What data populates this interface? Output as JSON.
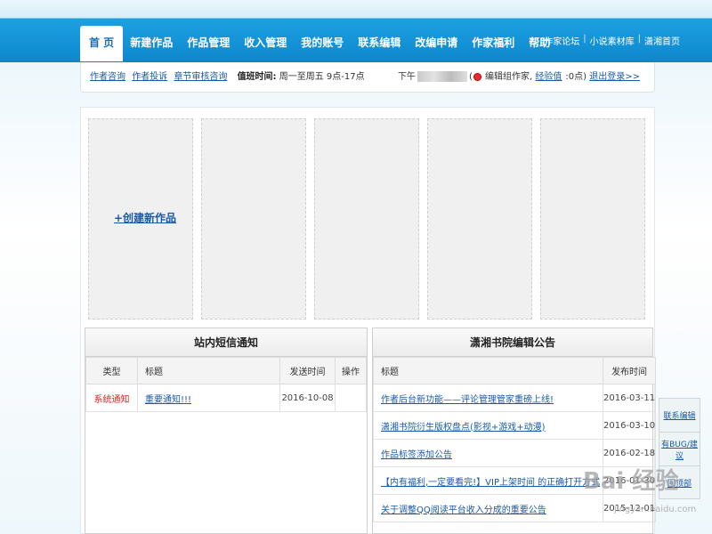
{
  "nav": {
    "items": [
      "首 页",
      "新建作品",
      "作品管理",
      "收入管理",
      "我的账号",
      "联系编辑",
      "改编申请",
      "作家福利",
      "帮助"
    ],
    "active": "首 页"
  },
  "top_links": [
    "作家论坛",
    "小说素材库",
    "潇湘首页"
  ],
  "subbar": {
    "links": [
      "作者咨询",
      "作者投诉",
      "章节审核咨询"
    ],
    "hours_label": "值班时间:",
    "hours_value": "周一至周五 9点-17点",
    "greeting_prefix": "下午",
    "role_text": "编辑组作家,",
    "exp_label": "经验值",
    "exp_value": ":0点)",
    "logout": "退出登录>>"
  },
  "create_work": "+创建新作品",
  "messages_panel": {
    "title": "站内短信通知",
    "columns": [
      "类型",
      "标题",
      "发送时间",
      "操作"
    ],
    "rows": [
      {
        "type": "系统通知",
        "title": "重要通知!!!",
        "time": "2016-10-08",
        "action": ""
      }
    ]
  },
  "announcements_panel": {
    "title": "潇湘书院编辑公告",
    "columns": [
      "标题",
      "发布时间"
    ],
    "rows": [
      {
        "title": "作者后台新功能——评论管理管家重磅上线!",
        "date": "2016-03-11"
      },
      {
        "title": "潇湘书院衍生版权盘点(影视+游戏+动漫)",
        "date": "2016-03-10"
      },
      {
        "title": "作品标签添加公告",
        "date": "2016-02-18"
      },
      {
        "title": "【内有福利,一定要看完!】VIP上架时间 的正确打开方式",
        "date": "2016-01-30"
      },
      {
        "title": "关于调整QQ阅读平台收入分成的重要公告",
        "date": "2015-12-01"
      }
    ]
  },
  "side_tabs": [
    "联系编辑",
    "有BUG/建议",
    "回顶部"
  ],
  "watermark": "Bai 经验",
  "watermark_sub": "jingyan.baidu.com",
  "colors": {
    "nav_blue": "#1493d7",
    "link_blue": "#1a5aa8",
    "alert_red": "#e02020"
  }
}
